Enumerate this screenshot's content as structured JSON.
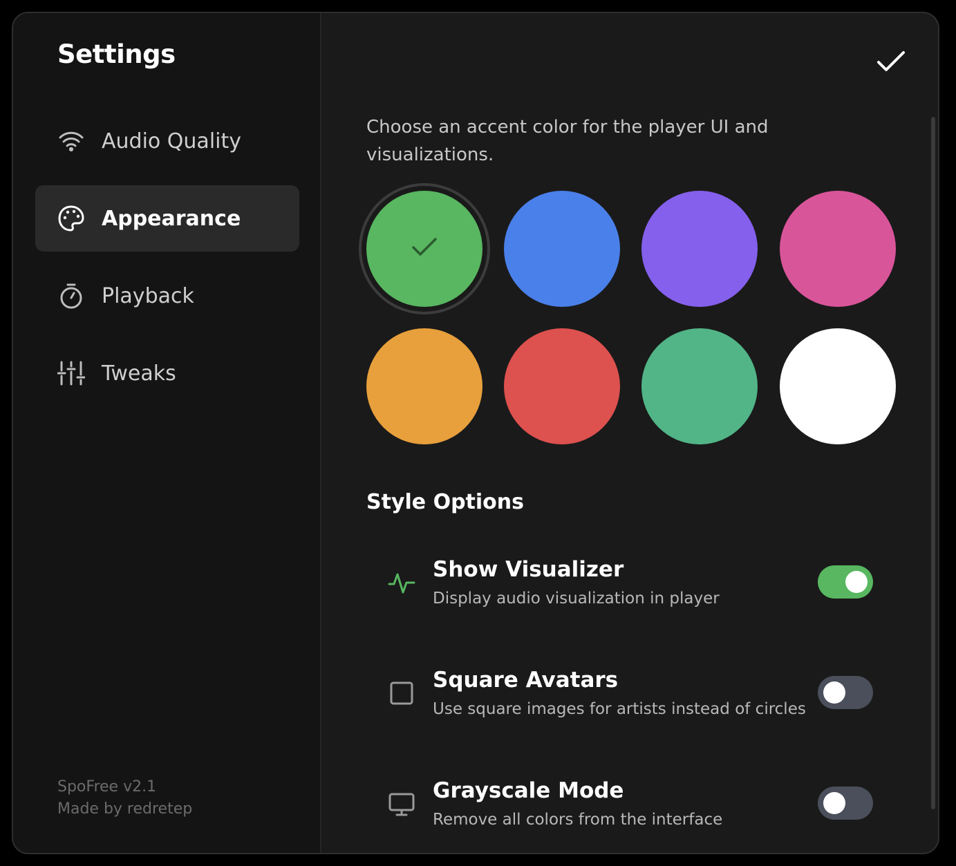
{
  "sidebar": {
    "title": "Settings",
    "items": [
      {
        "label": "Audio Quality",
        "icon": "wifi-icon"
      },
      {
        "label": "Appearance",
        "icon": "palette-icon",
        "active": true
      },
      {
        "label": "Playback",
        "icon": "timer-icon"
      },
      {
        "label": "Tweaks",
        "icon": "sliders-icon"
      }
    ],
    "footer": {
      "version": "SpoFree v2.1",
      "credit": "Made by redretep"
    }
  },
  "main": {
    "description": "Choose an accent color for the player UI and visualizations.",
    "swatches": [
      {
        "color": "#58b760",
        "selected": true
      },
      {
        "color": "#4a80ea"
      },
      {
        "color": "#8560ec"
      },
      {
        "color": "#d9559a"
      },
      {
        "color": "#e8a03c"
      },
      {
        "color": "#dd514e"
      },
      {
        "color": "#51b587"
      },
      {
        "color": "#ffffff"
      }
    ],
    "section_title": "Style Options",
    "options": [
      {
        "title": "Show Visualizer",
        "subtitle": "Display audio visualization in player",
        "icon": "activity-icon",
        "enabled": true
      },
      {
        "title": "Square Avatars",
        "subtitle": "Use square images for artists instead of circles",
        "icon": "square-icon",
        "enabled": false
      },
      {
        "title": "Grayscale Mode",
        "subtitle": "Remove all colors from the interface",
        "icon": "monitor-icon",
        "enabled": false
      }
    ]
  },
  "colors": {
    "accent": "#58b760",
    "toggle_off": "#4a4f5b"
  }
}
